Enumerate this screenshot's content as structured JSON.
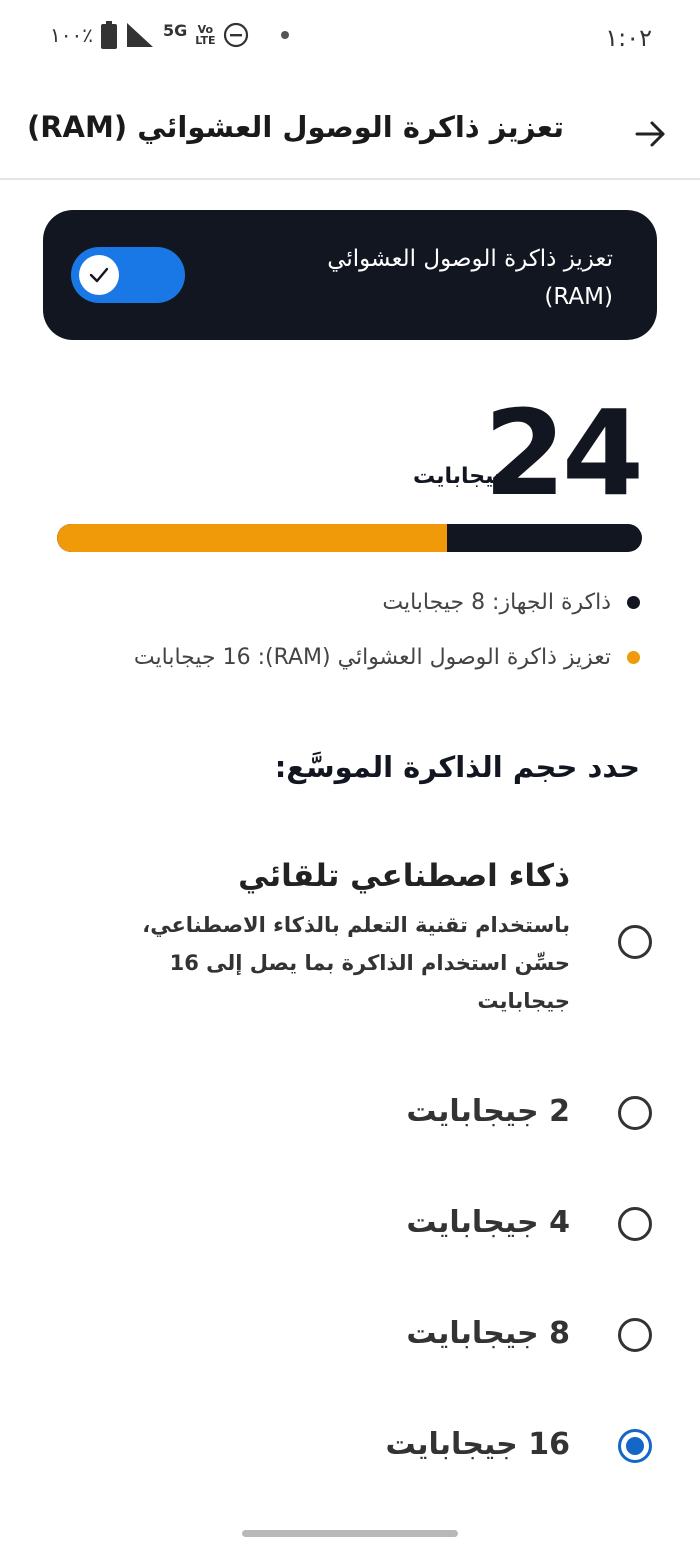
{
  "status_bar": {
    "time": "١:٠٢",
    "battery": "١٠٠٪",
    "network": "5G",
    "volte_top": "Vo",
    "volte_bottom": "LTE"
  },
  "header": {
    "title": "تعزيز ذاكرة الوصول العشوائي (RAM)"
  },
  "toggle": {
    "label": "تعزيز ذاكرة الوصول العشوائي (RAM)",
    "enabled": true,
    "color": "#1a78e6"
  },
  "memory": {
    "total_value": "24",
    "total_unit": "جيجابايت",
    "device_fraction": 0.3333,
    "expansion_fraction": 0.6667,
    "colors": {
      "device": "#121620",
      "expansion": "#f09a0a"
    },
    "legend": [
      {
        "text": "ذاكرة الجهاز: 8 جيجابايت",
        "color": "#121620"
      },
      {
        "text": "تعزيز ذاكرة الوصول العشوائي (RAM): 16 جيجابايت",
        "color": "#f09a0a"
      }
    ]
  },
  "size_section": {
    "title": "حدد حجم الذاكرة الموسَّع:",
    "ai_option": {
      "title": "ذكاء اصطناعي تلقائي",
      "description": "باستخدام تقنية التعلم بالذكاء الاصطناعي، حسِّن استخدام الذاكرة بما يصل إلى 16 جيجابايت",
      "selected": false
    },
    "options": [
      {
        "label": "2 جيجابايت",
        "selected": false
      },
      {
        "label": "4 جيجابايت",
        "selected": false
      },
      {
        "label": "8 جيجابايت",
        "selected": false
      },
      {
        "label": "16 جيجابايت",
        "selected": true
      }
    ]
  }
}
